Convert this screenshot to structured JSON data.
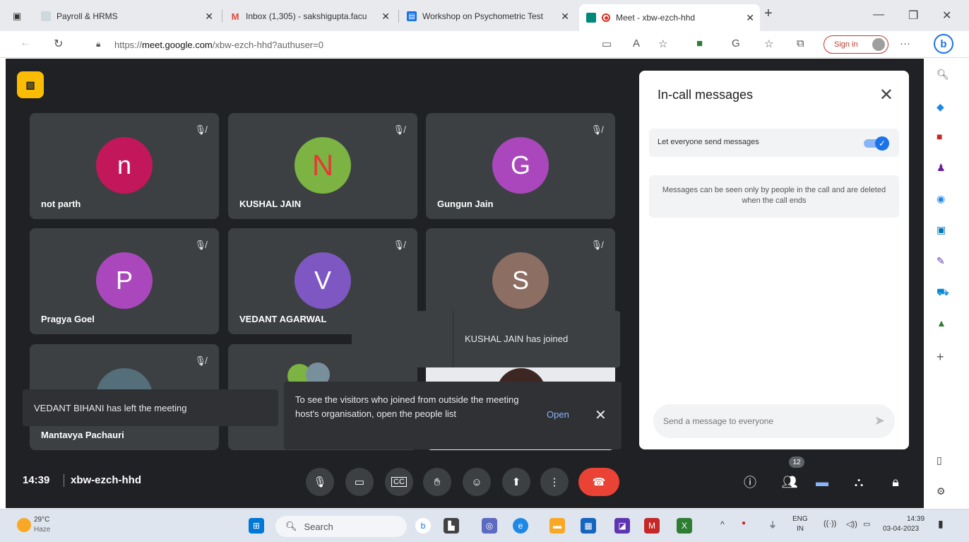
{
  "browser": {
    "tabs": [
      {
        "title": "Payroll & HRMS",
        "favicon": "payroll-icon"
      },
      {
        "title": "Inbox (1,305) - sakshigupta.facu",
        "favicon": "gmail-icon"
      },
      {
        "title": "Workshop on Psychometric Test",
        "favicon": "forms-icon"
      },
      {
        "title": "Meet - xbw-ezch-hhd",
        "favicon": "meet-icon"
      }
    ],
    "url_prefix": "https://",
    "url_domain": "meet.google.com",
    "url_path": "/xbw-ezch-hhd?authuser=0",
    "signin_label": "Sign in"
  },
  "meet": {
    "participants": [
      {
        "initial": "n",
        "name": "not parth",
        "color": "#c2185b"
      },
      {
        "initial": "N",
        "name": "KUSHAL JAIN",
        "color": "#7cb342",
        "initial_color": "#e53935"
      },
      {
        "initial": "G",
        "name": "Gungun Jain",
        "color": "#ab47bc"
      },
      {
        "initial": "P",
        "name": "Pragya Goel",
        "color": "#ab47bc"
      },
      {
        "initial": "V",
        "name": "VEDANT AGARWAL",
        "color": "#7e57c2"
      },
      {
        "initial": "S",
        "name": "",
        "color": "#8d6e63"
      },
      {
        "initial": "",
        "name": "Mantavya Pachauri",
        "color": "#546e7a"
      }
    ],
    "toast_joined": "KUSHAL JAIN has joined",
    "toast_left": "VEDANT BIHANI has left the meeting",
    "toast_visitors": "To see the visitors who joined from outside the meeting host's organisation, open the people list",
    "toast_open": "Open",
    "time": "14:39",
    "meeting_code": "xbw-ezch-hhd",
    "people_count": "12"
  },
  "chat": {
    "title": "In-call messages",
    "let_everyone_label": "Let everyone send messages",
    "info": "Messages can be seen only by people in the call and are deleted when the call ends",
    "input_placeholder": "Send a message to everyone"
  },
  "taskbar": {
    "temp": "29°C",
    "weather": "Haze",
    "search_label": "Search",
    "lang": "ENG",
    "region": "IN",
    "clock_time": "14:39",
    "clock_date": "03-04-2023"
  }
}
